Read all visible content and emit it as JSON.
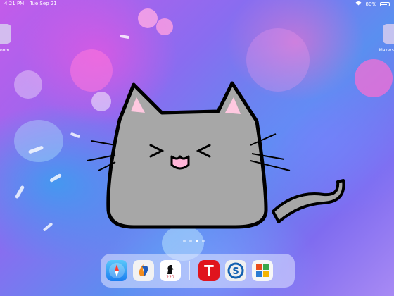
{
  "status_bar": {
    "time": "4:21 PM",
    "date": "Tue Sep 21",
    "battery": "80%"
  },
  "edge_apps": {
    "left_label": "oom",
    "right_label": "Makers"
  },
  "home": {
    "wallpaper_drawing": "gray-cat-icon",
    "page_count": 4,
    "active_page": 3
  },
  "dock": {
    "apps": [
      {
        "name": "safari-icon"
      },
      {
        "name": "orange-blue-app-icon"
      },
      {
        "name": "chess-app-icon",
        "badge_text": "220"
      },
      {
        "name": "t-app-icon",
        "letter": "T"
      },
      {
        "name": "s-app-icon"
      },
      {
        "name": "office-app-icon"
      }
    ]
  },
  "colors": {
    "cat_fill": "#a7a7a7",
    "cat_outline": "#000000",
    "ear_inner": "#ffc8e0",
    "tongue": "#ffb6d8"
  }
}
